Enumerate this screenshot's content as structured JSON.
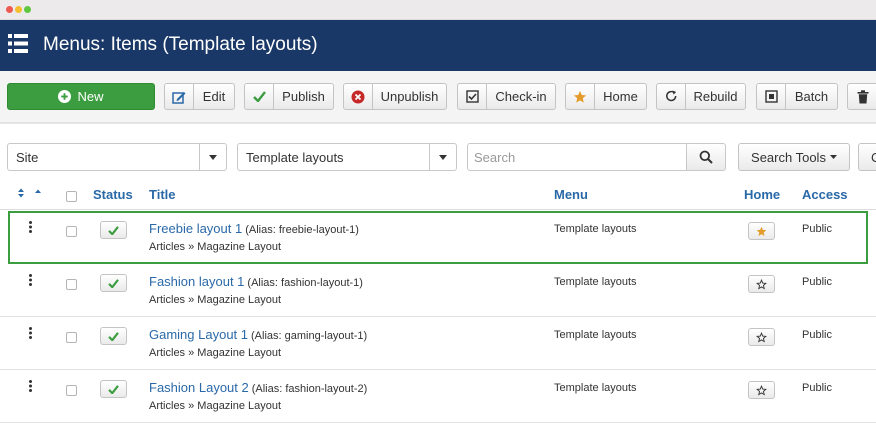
{
  "colors": {
    "header_bg": "#1a3867",
    "accent_green": "#3c9d40",
    "link_blue": "#2a69a8",
    "star_orange": "#e39b2a"
  },
  "header": {
    "title": "Menus: Items (Template layouts)",
    "icon": "list-icon"
  },
  "toolbar": {
    "new_label": "New",
    "edit_label": "Edit",
    "publish_label": "Publish",
    "unpublish_label": "Unpublish",
    "checkin_label": "Check-in",
    "home_label": "Home",
    "rebuild_label": "Rebuild",
    "batch_label": "Batch"
  },
  "filters": {
    "site_select": "Site",
    "menu_select": "Template layouts",
    "search_placeholder": "Search",
    "search_tools_label": "Search Tools",
    "clear_label": "C"
  },
  "table": {
    "columns": {
      "status": "Status",
      "title": "Title",
      "menu": "Menu",
      "home": "Home",
      "access": "Access"
    },
    "rows": [
      {
        "title": "Freebie layout 1",
        "alias": "(Alias: freebie-layout-1)",
        "sub": "Articles » Magazine Layout",
        "menu": "Template layouts",
        "home": true,
        "access": "Public",
        "selected": true
      },
      {
        "title": "Fashion layout 1",
        "alias": "(Alias: fashion-layout-1)",
        "sub": "Articles » Magazine Layout",
        "menu": "Template layouts",
        "home": false,
        "access": "Public",
        "selected": false
      },
      {
        "title": "Gaming Layout 1",
        "alias": "(Alias: gaming-layout-1)",
        "sub": "Articles » Magazine Layout",
        "menu": "Template layouts",
        "home": false,
        "access": "Public",
        "selected": false
      },
      {
        "title": "Fashion Layout 2",
        "alias": "(Alias: fashion-layout-2)",
        "sub": "Articles » Magazine Layout",
        "menu": "Template layouts",
        "home": false,
        "access": "Public",
        "selected": false
      }
    ]
  }
}
